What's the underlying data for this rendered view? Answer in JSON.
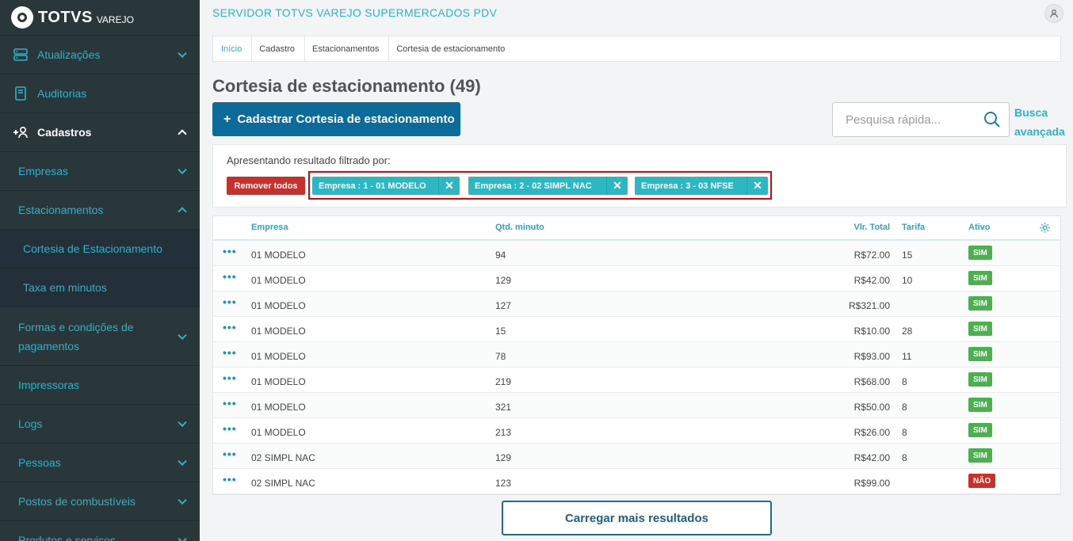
{
  "sidebar": {
    "brand": "TOTVS",
    "brand_sub": "VAREJO",
    "items": [
      {
        "label": "Atualizações",
        "icon": "server-icon"
      },
      {
        "label": "Auditorias",
        "icon": "book-icon"
      },
      {
        "label": "Cadastros",
        "icon": "add-user-icon"
      },
      {
        "label": "Empresas"
      },
      {
        "label": "Estacionamentos"
      },
      {
        "label": "Cortesia de Estacionamento"
      },
      {
        "label": "Taxa em minutos"
      },
      {
        "label": "Formas e condições de pagamentos"
      },
      {
        "label": "Impressoras"
      },
      {
        "label": "Logs"
      },
      {
        "label": "Pessoas"
      },
      {
        "label": "Postos de combustíveis"
      },
      {
        "label": "Produtos e serviços"
      }
    ]
  },
  "header": {
    "app_title": "SERVIDOR TOTVS VAREJO SUPERMERCADOS PDV"
  },
  "breadcrumb": [
    "Início",
    "Cadastro",
    "Estacionamentos",
    "Cortesia de estacionamento"
  ],
  "page": {
    "title": "Cortesia de estacionamento (49)",
    "new_button": "Cadastrar Cortesia de estacionamento",
    "new_button_plus": "+",
    "search_placeholder": "Pesquisa rápida...",
    "advanced_search_line1": "Busca",
    "advanced_search_line2": "avançada",
    "load_more": "Carregar mais resultados"
  },
  "filter": {
    "label": "Apresentando resultado filtrado por:",
    "remove_all": "Remover todos",
    "chips": [
      "Empresa : 1 - 01 MODELO",
      "Empresa : 2 - 02 SIMPL NAC",
      "Empresa : 3 - 03 NFSE"
    ]
  },
  "table": {
    "columns": {
      "empresa": "Empresa",
      "qtd": "Qtd. minuto",
      "total": "Vlr. Total",
      "tarifa": "Tarifa",
      "ativo": "Ativo"
    },
    "rows": [
      {
        "empresa": "01 MODELO",
        "qtd": "94",
        "total": "R$72.00",
        "tarifa": "15",
        "ativo": "SIM"
      },
      {
        "empresa": "01 MODELO",
        "qtd": "129",
        "total": "R$42.00",
        "tarifa": "10",
        "ativo": "SIM"
      },
      {
        "empresa": "01 MODELO",
        "qtd": "127",
        "total": "R$321.00",
        "tarifa": "",
        "ativo": "SIM"
      },
      {
        "empresa": "01 MODELO",
        "qtd": "15",
        "total": "R$10.00",
        "tarifa": "28",
        "ativo": "SIM"
      },
      {
        "empresa": "01 MODELO",
        "qtd": "78",
        "total": "R$93.00",
        "tarifa": "11",
        "ativo": "SIM"
      },
      {
        "empresa": "01 MODELO",
        "qtd": "219",
        "total": "R$68.00",
        "tarifa": "8",
        "ativo": "SIM"
      },
      {
        "empresa": "01 MODELO",
        "qtd": "321",
        "total": "R$50.00",
        "tarifa": "8",
        "ativo": "SIM"
      },
      {
        "empresa": "01 MODELO",
        "qtd": "213",
        "total": "R$26.00",
        "tarifa": "8",
        "ativo": "SIM"
      },
      {
        "empresa": "02 SIMPL NAC",
        "qtd": "129",
        "total": "R$42.00",
        "tarifa": "8",
        "ativo": "SIM"
      },
      {
        "empresa": "02 SIMPL NAC",
        "qtd": "123",
        "total": "R$99.00",
        "tarifa": "",
        "ativo": "NÃO"
      }
    ],
    "row_menu": "•••"
  },
  "colors": {
    "sidebar_bg": "#29373b",
    "accent": "#2fb1c9",
    "primary": "#0c6b9a",
    "danger": "#c9302c",
    "success": "#4caf50",
    "chip": "#2cb7c3"
  }
}
